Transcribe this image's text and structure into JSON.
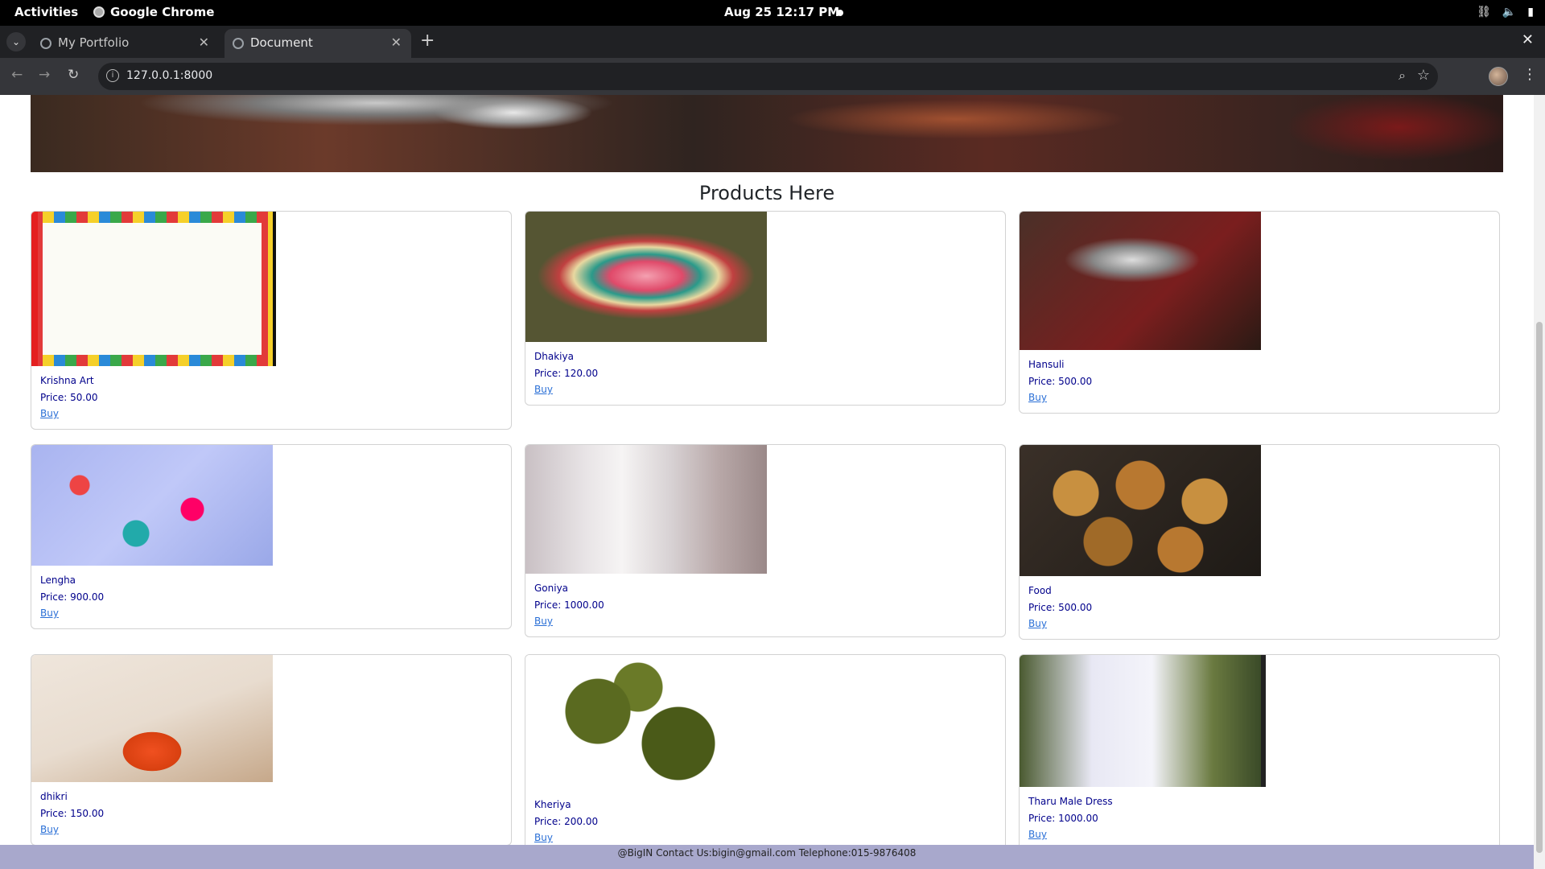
{
  "system_bar": {
    "activities": "Activities",
    "app_name": "Google Chrome",
    "clock": "Aug 25  12:17 PM"
  },
  "browser": {
    "tabs": [
      {
        "title": "My Portfolio",
        "active": false
      },
      {
        "title": "Document",
        "active": true
      }
    ],
    "url": "127.0.0.1:8000"
  },
  "page": {
    "section_title": "Products Here",
    "buy_label": "Buy",
    "products": [
      {
        "name": "Krishna Art",
        "price": "Price: 50.00"
      },
      {
        "name": "Dhakiya",
        "price": "Price: 120.00"
      },
      {
        "name": "Hansuli",
        "price": "Price: 500.00"
      },
      {
        "name": "Lengha",
        "price": "Price: 900.00"
      },
      {
        "name": "Goniya",
        "price": "Price: 1000.00"
      },
      {
        "name": "Food",
        "price": "Price: 500.00"
      },
      {
        "name": "dhikri",
        "price": "Price: 150.00"
      },
      {
        "name": "Kheriya",
        "price": "Price: 200.00"
      },
      {
        "name": "Tharu Male Dress",
        "price": "Price: 1000.00"
      }
    ],
    "footer": "@BigIN Contact Us:bigin@gmail.com Telephone:015-9876408"
  },
  "colors": {
    "product_text": "#00008b",
    "link": "#2a6fd6",
    "footer_bg": "#a8a8cc"
  }
}
